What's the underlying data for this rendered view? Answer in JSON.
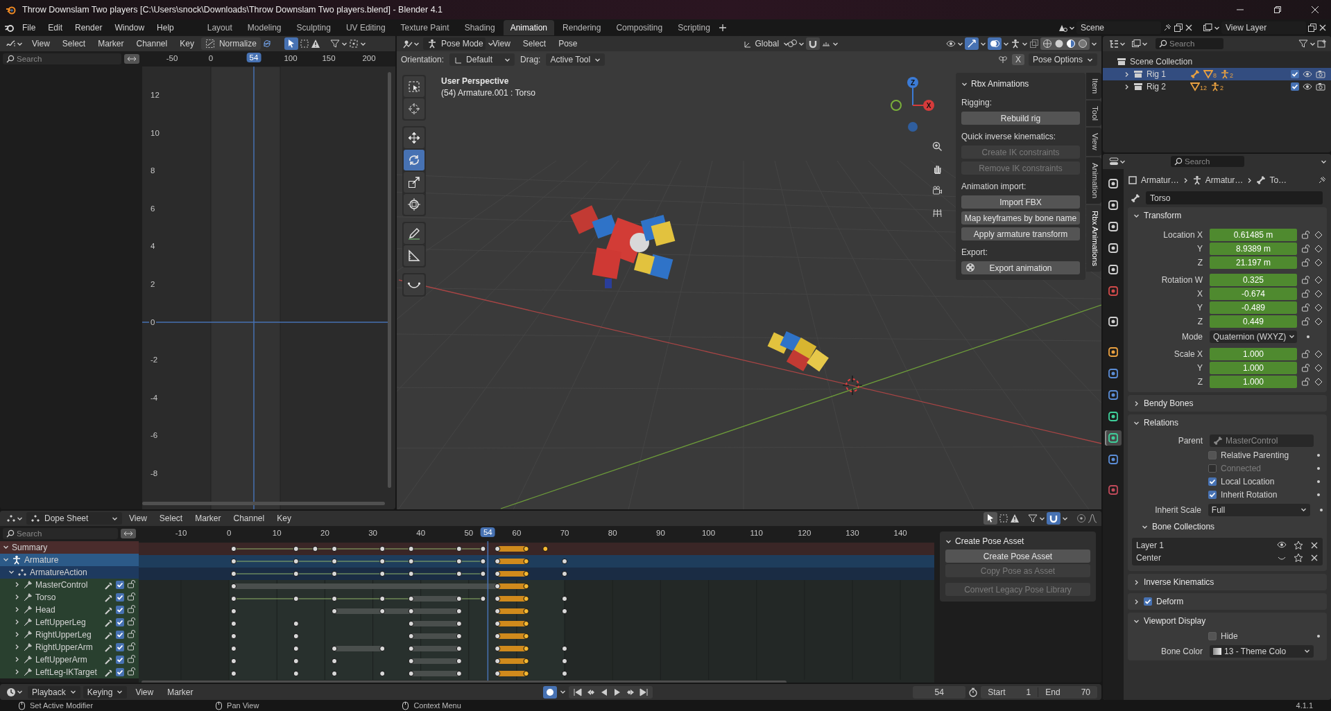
{
  "window": {
    "title": "Throw Downslam Two players [C:\\Users\\snock\\Downloads\\Throw Downslam Two players.blend] - Blender 4.1"
  },
  "menu": [
    "File",
    "Edit",
    "Render",
    "Window",
    "Help"
  ],
  "workspaces": [
    {
      "label": "Layout",
      "selected": false
    },
    {
      "label": "Modeling",
      "selected": false
    },
    {
      "label": "Sculpting",
      "selected": false
    },
    {
      "label": "UV Editing",
      "selected": false
    },
    {
      "label": "Texture Paint",
      "selected": false
    },
    {
      "label": "Shading",
      "selected": false
    },
    {
      "label": "Animation",
      "selected": true
    },
    {
      "label": "Rendering",
      "selected": false
    },
    {
      "label": "Compositing",
      "selected": false
    },
    {
      "label": "Scripting",
      "selected": false
    }
  ],
  "scene": {
    "scene": "Scene",
    "view_layer": "View Layer"
  },
  "graph_editor": {
    "menus": [
      "View",
      "Select",
      "Marker",
      "Channel",
      "Key"
    ],
    "normalize": "Normalize",
    "search_placeholder": "Search",
    "frame_ticks": [
      "-50",
      "0",
      "100",
      "150",
      "200"
    ],
    "current_frame": "54",
    "value_ticks": [
      "12",
      "10",
      "8",
      "6",
      "4",
      "2",
      "0",
      "-2",
      "-4",
      "-6",
      "-8"
    ]
  },
  "viewport": {
    "mode": "Pose Mode",
    "menus": [
      "View",
      "Select",
      "Pose"
    ],
    "transform_orientation": "Global",
    "orientation_label": "Orientation:",
    "orientation": "Default",
    "drag_label": "Drag:",
    "drag": "Active Tool",
    "mirror_x": "X",
    "pose_options": "Pose Options",
    "view_name": "User Perspective",
    "view_info": "(54) Armature.001 : Torso",
    "gizmo": [
      "Z",
      "X"
    ],
    "tools": [
      {
        "kind": "select_box",
        "selected": false
      },
      {
        "kind": "cursor",
        "selected": false
      },
      {
        "kind": "move",
        "selected": false
      },
      {
        "kind": "rotate",
        "selected": true
      },
      {
        "kind": "scale",
        "selected": false
      },
      {
        "kind": "transform",
        "selected": false
      },
      {
        "kind": "annotate",
        "selected": false
      },
      {
        "kind": "measure",
        "selected": false
      },
      {
        "kind": "curve",
        "selected": false
      }
    ],
    "side_tabs": [
      {
        "label": "Item",
        "selected": false
      },
      {
        "label": "Tool",
        "selected": false
      },
      {
        "label": "View",
        "selected": false
      },
      {
        "label": "Animation",
        "selected": false
      },
      {
        "label": "Rbx Animations",
        "selected": true
      }
    ],
    "panel": {
      "title": "Rbx Animations",
      "items": [
        {
          "kind": "label",
          "text": "Rigging:"
        },
        {
          "kind": "button",
          "text": "Rebuild rig",
          "disabled": false
        },
        {
          "kind": "label",
          "text": "Quick inverse kinematics:"
        },
        {
          "kind": "button",
          "text": "Create IK constraints",
          "disabled": true
        },
        {
          "kind": "button",
          "text": "Remove IK constraints",
          "disabled": true
        },
        {
          "kind": "label",
          "text": "Animation import:"
        },
        {
          "kind": "button",
          "text": "Import FBX",
          "disabled": false
        },
        {
          "kind": "button",
          "text": "Map keyframes by bone name",
          "disabled": false
        },
        {
          "kind": "button",
          "text": "Apply armature transform",
          "disabled": false
        },
        {
          "kind": "label",
          "text": "Export:"
        },
        {
          "kind": "icon_button",
          "text": "Export animation",
          "disabled": false
        }
      ]
    }
  },
  "outliner": {
    "search_placeholder": "Search",
    "root": "Scene Collection",
    "items": [
      {
        "label": "Rig 1",
        "selected": true,
        "checked": true,
        "counts": [
          "8",
          "2"
        ]
      },
      {
        "label": "Rig 2",
        "selected": false,
        "checked": true,
        "counts": [
          "12",
          "2"
        ]
      }
    ]
  },
  "properties": {
    "search_placeholder": "Search",
    "tabs": [
      {
        "kind": "tool",
        "selected": false
      },
      {
        "kind": "render",
        "selected": false
      },
      {
        "kind": "output",
        "selected": false
      },
      {
        "kind": "view-layer",
        "selected": false
      },
      {
        "kind": "scene",
        "selected": false
      },
      {
        "kind": "world",
        "selected": false
      },
      {
        "kind": "collection",
        "selected": false
      },
      {
        "kind": "object",
        "selected": false
      },
      {
        "kind": "modifier",
        "selected": false
      },
      {
        "kind": "physics",
        "selected": false
      },
      {
        "kind": "armature",
        "selected": false
      },
      {
        "kind": "bone",
        "selected": true
      },
      {
        "kind": "constraint",
        "selected": false
      },
      {
        "kind": "texture",
        "selected": false
      }
    ],
    "breadcrumb": [
      "Armatur…",
      "Armatur…",
      "To…"
    ],
    "bone_name": "Torso",
    "sections": [
      {
        "title": "Transform",
        "expanded": true,
        "items": [
          {
            "kind": "vector",
            "rows": [
              {
                "label": "Location X",
                "value": "0.61485 m"
              },
              {
                "label": "Y",
                "value": "8.9389 m"
              },
              {
                "label": "Z",
                "value": "21.197 m"
              }
            ]
          },
          {
            "kind": "vector",
            "rows": [
              {
                "label": "Rotation W",
                "value": "0.325"
              },
              {
                "label": "X",
                "value": "-0.674"
              },
              {
                "label": "Y",
                "value": "-0.489"
              },
              {
                "label": "Z",
                "value": "0.449"
              }
            ]
          },
          {
            "kind": "dropdown",
            "label": "Mode",
            "value": "Quaternion (WXYZ)"
          },
          {
            "kind": "vector",
            "rows": [
              {
                "label": "Scale X",
                "value": "1.000"
              },
              {
                "label": "Y",
                "value": "1.000"
              },
              {
                "label": "Z",
                "value": "1.000"
              }
            ]
          }
        ]
      },
      {
        "title": "Bendy Bones",
        "expanded": false
      },
      {
        "title": "Relations",
        "expanded": true,
        "items": [
          {
            "kind": "parent",
            "label": "Parent",
            "value": "MasterControl"
          },
          {
            "kind": "checkbox",
            "label": "Relative Parenting",
            "checked": false,
            "disabled": false
          },
          {
            "kind": "checkbox",
            "label": "Connected",
            "checked": false,
            "disabled": true
          },
          {
            "kind": "checkbox",
            "label": "Local Location",
            "checked": true,
            "disabled": false
          },
          {
            "kind": "checkbox",
            "label": "Inherit Rotation",
            "checked": true,
            "disabled": false
          },
          {
            "kind": "dropdown",
            "label": "Inherit Scale",
            "value": "Full"
          },
          {
            "kind": "subpanel",
            "title": "Bone Collections",
            "expanded": true,
            "entries": [
              {
                "name": "Layer 1",
                "visible": true
              },
              {
                "name": "Center",
                "visible": false
              }
            ]
          }
        ]
      },
      {
        "title": "Inverse Kinematics",
        "expanded": false
      },
      {
        "title": "Deform",
        "expanded": false,
        "checked": true
      },
      {
        "title": "Viewport Display",
        "expanded": true,
        "items": [
          {
            "kind": "checkbox",
            "label": "Hide",
            "checked": false,
            "disabled": false
          },
          {
            "kind": "color",
            "label": "Bone Color",
            "value": "13 - Theme Colo"
          }
        ]
      }
    ]
  },
  "dope_sheet": {
    "mode": "Dope Sheet",
    "menus": [
      "View",
      "Select",
      "Marker",
      "Channel",
      "Key"
    ],
    "search_placeholder": "Search",
    "frame_ticks": [
      "-10",
      "0",
      "10",
      "20",
      "30",
      "40",
      "50",
      "60",
      "70",
      "80",
      "90",
      "100",
      "110",
      "120",
      "130",
      "140"
    ],
    "current_frame": "54",
    "channels": [
      {
        "name": "Summary",
        "kind": "summary",
        "expanded": true
      },
      {
        "name": "Armature",
        "kind": "object",
        "expanded": true
      },
      {
        "name": "ArmatureAction",
        "kind": "action",
        "expanded": true
      },
      {
        "name": "MasterControl",
        "kind": "bone",
        "expanded": false,
        "checked": true,
        "locked": false
      },
      {
        "name": "Torso",
        "kind": "bone",
        "expanded": false,
        "checked": true,
        "locked": false
      },
      {
        "name": "Head",
        "kind": "bone",
        "expanded": false,
        "checked": true,
        "locked": false
      },
      {
        "name": "LeftUpperLeg",
        "kind": "bone",
        "expanded": false,
        "checked": true,
        "locked": false
      },
      {
        "name": "RightUpperLeg",
        "kind": "bone",
        "expanded": false,
        "checked": true,
        "locked": false
      },
      {
        "name": "RightUpperArm",
        "kind": "bone",
        "expanded": false,
        "checked": true,
        "locked": false
      },
      {
        "name": "LeftUpperArm",
        "kind": "bone",
        "expanded": false,
        "checked": true,
        "locked": false
      },
      {
        "name": "LeftLeg-IKTarget",
        "kind": "bone",
        "expanded": false,
        "checked": true,
        "locked": false
      }
    ],
    "panel": {
      "title": "Create Pose Asset",
      "buttons": [
        {
          "label": "Create Pose Asset",
          "disabled": false
        },
        {
          "label": "Copy Pose as Asset",
          "disabled": true
        },
        {
          "label": "Convert Legacy Pose Library",
          "disabled": true
        }
      ]
    }
  },
  "timeline": {
    "menus": [
      {
        "label": "Playback",
        "kind": "dropdown"
      },
      {
        "label": "Keying",
        "kind": "dropdown"
      },
      {
        "label": "View",
        "kind": "menu"
      },
      {
        "label": "Marker",
        "kind": "menu"
      }
    ],
    "auto_keying": true,
    "current_frame": "54",
    "start_label": "Start",
    "start": "1",
    "end_label": "End",
    "end": "70"
  },
  "status_bar": {
    "hints": [
      "Set Active Modifier",
      "Pan View",
      "Context Menu"
    ],
    "version": "4.1.1"
  }
}
